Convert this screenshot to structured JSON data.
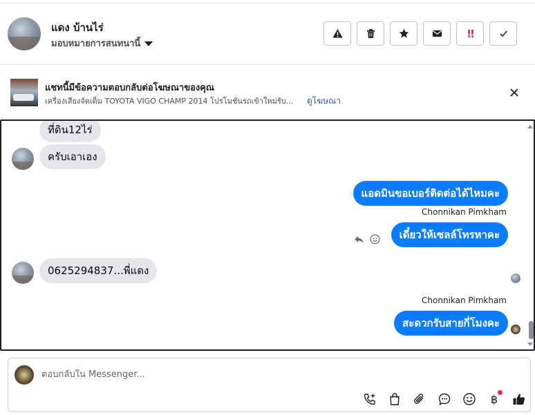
{
  "header": {
    "contact_name": "แดง บ้านไร่",
    "assign_label": "มอบหมายการสนทนานี้",
    "actions": [
      "alert-icon",
      "trash-icon",
      "star-icon",
      "mail-icon",
      "spam-icon",
      "check-icon"
    ],
    "spam_glyph": "!!"
  },
  "ad": {
    "title": "แชทนี้มีข้อความตอบกลับต่อโฆษณาของคุณ",
    "subtitle": "เครื่องเสียงจัดเต็ม TOYOTA VIGO CHAMP 2014 โปรโมชั่นรถเข้าใหม่รับ...",
    "link_label": "ดูโฆษณา"
  },
  "messages": [
    {
      "side": "in",
      "text": "ที่ดิน12ไร่"
    },
    {
      "side": "in",
      "text": "ครับเอาเอง"
    },
    {
      "side": "out",
      "text": "แอดมินขอเบอร์ติดต่อได้ไหมคะ"
    },
    {
      "side": "out",
      "sender": "Chonnikan Pimkham",
      "text": "เดี๋ยวให้เซลล์โทรหาคะ"
    },
    {
      "side": "in",
      "text": "0625294837...พี่แดง"
    },
    {
      "side": "out",
      "sender": "Chonnikan Pimkham",
      "text": "สะดวกรับสายกี่โมงคะ"
    }
  ],
  "composer": {
    "placeholder": "ตอบกลับใน Messenger...",
    "icons": [
      "call-add-icon",
      "shopping-bag-icon",
      "paperclip-icon",
      "saved-reply-icon",
      "emoji-icon",
      "baht-icon",
      "like-icon"
    ],
    "baht_glyph": "฿"
  },
  "colors": {
    "accent": "#0a7cff",
    "incoming_bubble": "#e4e6eb",
    "link": "#385898",
    "notification_dot": "#f02849"
  }
}
